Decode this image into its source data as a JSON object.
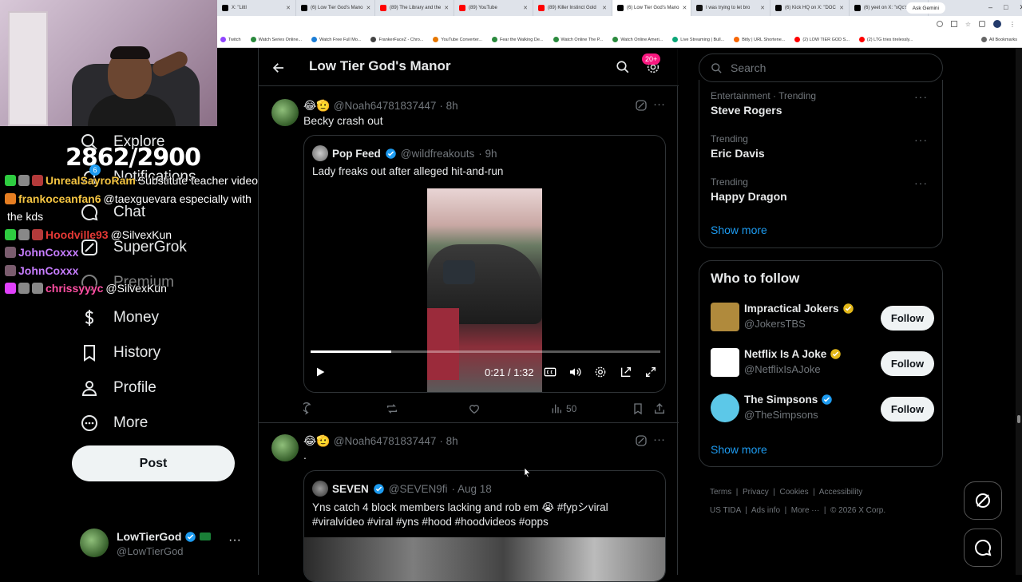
{
  "browser": {
    "tabs": [
      {
        "label": "X: \"Littl",
        "color": "#000000",
        "active": false
      },
      {
        "label": "(6) Low Tier God's Mano",
        "color": "#000000",
        "active": false
      },
      {
        "label": "(89) The Library and the",
        "color": "#ff0000",
        "active": false
      },
      {
        "label": "(89) YouTube",
        "color": "#ff0000",
        "active": false
      },
      {
        "label": "(89) Killer Instinct Gold",
        "color": "#ff0000",
        "active": false
      },
      {
        "label": "(6) Low Tier God's Mano",
        "color": "#000000",
        "active": true
      },
      {
        "label": "I was trying to let bro ",
        "color": "#111111",
        "active": false
      },
      {
        "label": "(6) Kick HQ on X: \"DOC",
        "color": "#000000",
        "active": false
      },
      {
        "label": "(6) yeet on X: \"xQc's Str",
        "color": "#000000",
        "active": false
      }
    ],
    "ask_gemini": "Ask Gemini",
    "bookmarks": [
      {
        "label": "Twitch",
        "color": "#9146ff"
      },
      {
        "label": "Watch Series Online...",
        "color": "#2b8a3e"
      },
      {
        "label": "Watch Free Full Mo...",
        "color": "#1c7ed6"
      },
      {
        "label": "FrankerFaceZ - Chro...",
        "color": "#444444"
      },
      {
        "label": "YouTube Converter...",
        "color": "#e67700"
      },
      {
        "label": "Fear the Walking De...",
        "color": "#2b8a3e"
      },
      {
        "label": "Watch Online The P...",
        "color": "#2b8a3e"
      },
      {
        "label": "Watch Online Ameri...",
        "color": "#2b8a3e"
      },
      {
        "label": "Live Streaming | Bull...",
        "color": "#0ca678"
      },
      {
        "label": "Bitly | URL Shortene...",
        "color": "#f76707"
      },
      {
        "label": "(2) LOW TIER GOD S...",
        "color": "#ff0000"
      },
      {
        "label": "(2) LTG tries tirelessly...",
        "color": "#ff0000"
      },
      {
        "label": "All Bookmarks",
        "color": "#666666"
      }
    ]
  },
  "overlay": {
    "score": "2862/2900",
    "chat": [
      {
        "user": "UnrealSayroRam",
        "user_color": "#f5c542",
        "message": "Substitute teacher video",
        "badges": [
          "#2ecc40",
          "#888888",
          "#b33a3a"
        ]
      },
      {
        "user": "frankoceanfan6",
        "user_color": "#f5c542",
        "message": "@taexguevara especially with",
        "badges": [
          "#e67e22"
        ]
      },
      {
        "user": "",
        "user_color": "#ffffff",
        "message": "the kds",
        "badges": []
      },
      {
        "user": "Hoodville93",
        "user_color": "#e53935",
        "message": "@SilvexKun",
        "badges": [
          "#2ecc40",
          "#888888",
          "#b33a3a"
        ]
      },
      {
        "user": "JohnCoxxx",
        "user_color": "#c77dff",
        "message": "",
        "badges": [
          "#7a5c6e"
        ]
      },
      {
        "user": "JohnCoxxx",
        "user_color": "#c77dff",
        "message": "",
        "badges": [
          "#7a5c6e"
        ]
      },
      {
        "user": "chrissyyyc",
        "user_color": "#ff4fa3",
        "message": "@SilvexKun",
        "badges": [
          "#e040fb",
          "#888888",
          "#888888"
        ]
      }
    ]
  },
  "nav": {
    "explore": "Explore",
    "notifications": "Notifications",
    "notifications_count": "6",
    "chat": "Chat",
    "grok": "SuperGrok",
    "premium": "Premium",
    "money": "Money",
    "history": "History",
    "profile": "Profile",
    "more": "More",
    "post_label": "Post",
    "account_name": "LowTierGod",
    "account_handle": "@LowTierGod"
  },
  "header": {
    "title": "Low Tier God's Manor",
    "badge_count": "20+"
  },
  "posts": [
    {
      "emojis": "😂🫡",
      "handle": "@Noah64781837447",
      "time": "· 8h",
      "text": "Becky crash out",
      "quote": {
        "name": "Pop Feed",
        "handle": "@wildfreakouts",
        "time": "· 9h",
        "text": "Lady freaks out after alleged hit-and-run",
        "video_time": "0:21 / 1:32",
        "progress": 0.23
      },
      "views": "50"
    },
    {
      "emojis": "😂🫡",
      "handle": "@Noah64781837447",
      "time": "· 8h",
      "text": ".",
      "quote": {
        "name": "SEVEN",
        "handle": "@SEVEN9fi",
        "time": "· Aug 18",
        "line1": "Yns catch 4 block members lacking and rob em 😭 #fypシviral",
        "line2": "#viralvídeo #viral #yns #hood #hoodvideos #opps"
      }
    }
  ],
  "search": {
    "placeholder": "Search"
  },
  "trends": [
    {
      "category": "Entertainment · Trending",
      "name": "Steve Rogers"
    },
    {
      "category": "Trending",
      "name": "Eric Davis"
    },
    {
      "category": "Trending",
      "name": "Happy Dragon"
    }
  ],
  "trends_show_more": "Show more",
  "who_to_follow": {
    "title": "Who to follow",
    "accounts": [
      {
        "name": "Impractical Jokers",
        "handle": "@JokersTBS",
        "badge": "gold",
        "avatar_color": "#b08a3c"
      },
      {
        "name": "Netflix Is A Joke",
        "handle": "@NetflixIsAJoke",
        "badge": "gold",
        "avatar_color": "#ffffff"
      },
      {
        "name": "The Simpsons",
        "handle": "@TheSimpsons",
        "badge": "blue",
        "avatar_color": "#5cc8e8"
      }
    ],
    "follow_label": "Follow",
    "show_more": "Show more"
  },
  "footer": {
    "terms": "Terms",
    "privacy": "Privacy",
    "cookies": "Cookies",
    "accessibility": "Accessibility",
    "ustida": "US TIDA",
    "ads": "Ads info",
    "more": "More ···",
    "copyright": "© 2026 X Corp."
  }
}
